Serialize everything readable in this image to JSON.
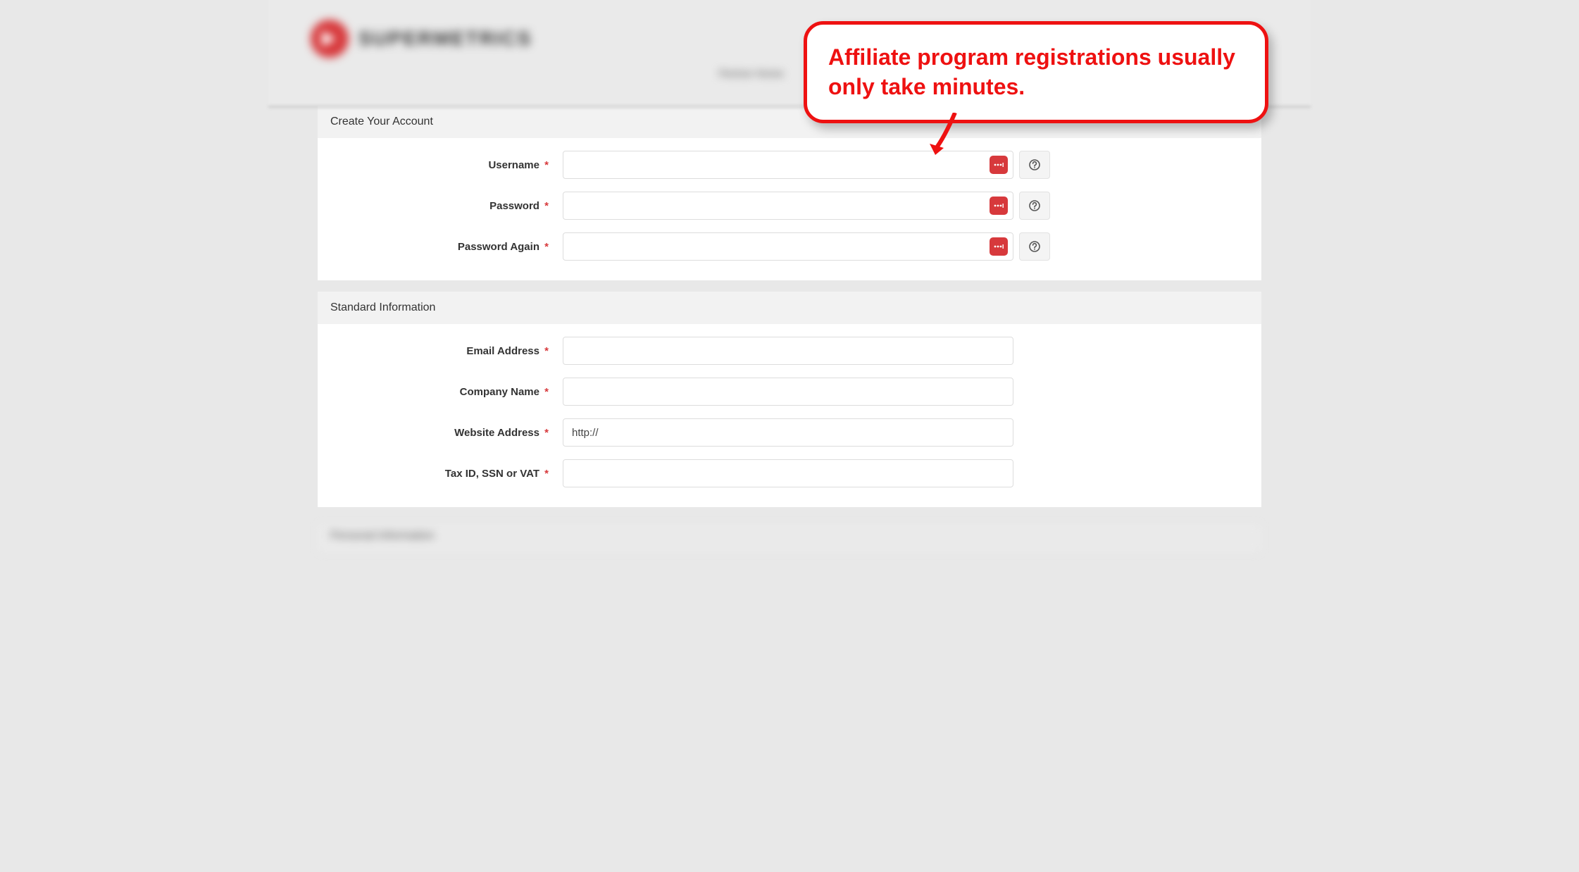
{
  "brand": {
    "name": "SUPERMETRICS",
    "nav_item": "Partner Home"
  },
  "callout": {
    "text": "Affiliate program registrations usually only take minutes."
  },
  "sections": {
    "account": {
      "title": "Create Your Account",
      "fields": {
        "username": {
          "label": "Username",
          "required_mark": "*"
        },
        "password": {
          "label": "Password",
          "required_mark": "*"
        },
        "password_again": {
          "label": "Password Again",
          "required_mark": "*"
        }
      }
    },
    "standard": {
      "title": "Standard Information",
      "fields": {
        "email": {
          "label": "Email Address",
          "required_mark": "*"
        },
        "company": {
          "label": "Company Name",
          "required_mark": "*"
        },
        "website": {
          "label": "Website Address",
          "required_mark": "*",
          "value": "http://"
        },
        "tax": {
          "label": "Tax ID, SSN or VAT",
          "required_mark": "*"
        }
      }
    },
    "personal_blur": {
      "title": "Personal Information"
    }
  }
}
